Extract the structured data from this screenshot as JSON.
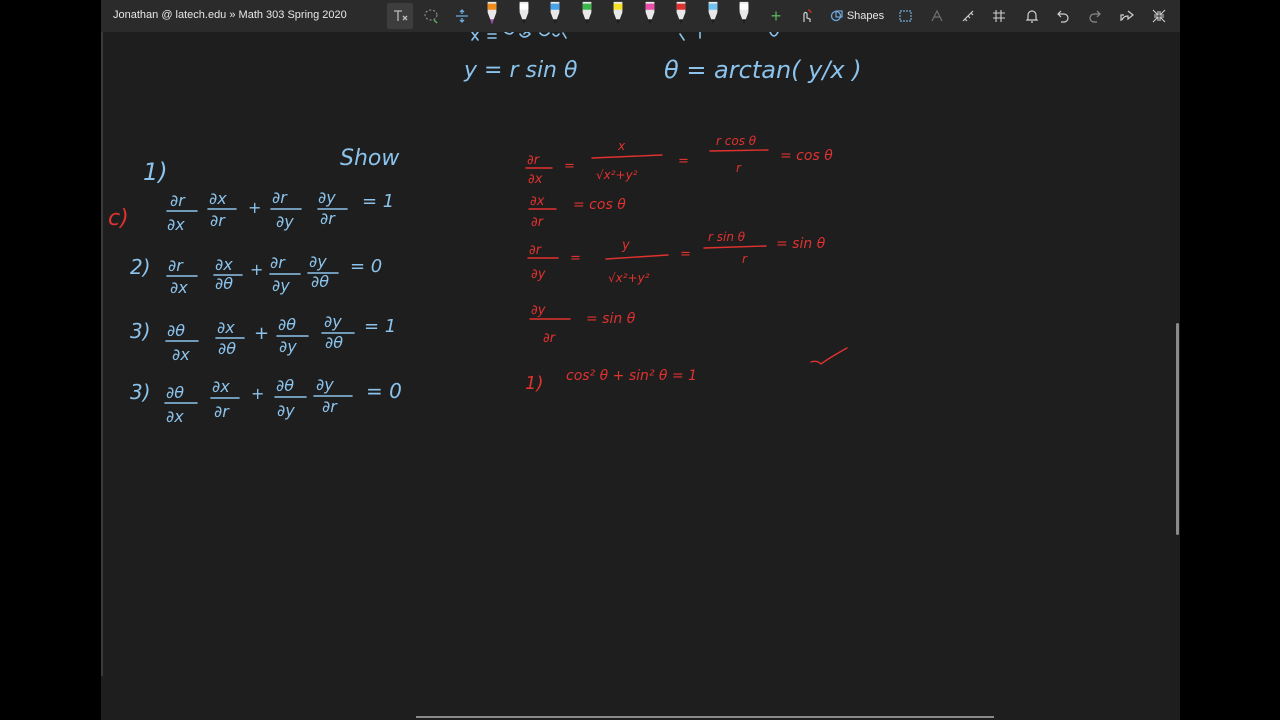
{
  "toolbar": {
    "breadcrumb": "Jonathan @ latech.edu » Math 303 Spring 2020",
    "shapes_label": "Shapes",
    "pens": [
      {
        "name": "pen-orange",
        "color": "#f08c1e",
        "tip": "#a94fb8"
      },
      {
        "name": "pen-white-1",
        "color": "#ffffff"
      },
      {
        "name": "pen-blue",
        "color": "#4aa3e8"
      },
      {
        "name": "pen-green",
        "color": "#3cb54a"
      },
      {
        "name": "highlighter-yellow",
        "color": "#f5e12a"
      },
      {
        "name": "pen-pink",
        "color": "#e94fa8"
      },
      {
        "name": "pen-red",
        "color": "#e0322f"
      },
      {
        "name": "pen-lightblue",
        "color": "#6fc3f0"
      },
      {
        "name": "pen-white-2",
        "color": "#ffffff"
      }
    ]
  },
  "ink": {
    "top_left": "y = r sin θ",
    "top_right": "θ = arctan( y/x )",
    "problem_label": "1)",
    "show": "Show",
    "circle_c": "c)",
    "eq1": [
      "∂r",
      "∂x",
      "∂x",
      "∂r",
      "+",
      "∂r",
      "∂y",
      "∂y",
      "∂r",
      "= 1"
    ],
    "eq2_label": "2)",
    "eq2": [
      "∂r",
      "∂x",
      "∂x",
      "∂θ",
      "+",
      "∂r",
      "∂y",
      "∂y",
      "∂θ",
      "= 0"
    ],
    "eq3_label": "3)",
    "eq3": [
      "∂θ",
      "∂x",
      "∂x",
      "∂θ",
      "+",
      "∂θ",
      "∂y",
      "∂y",
      "∂θ",
      "= 1"
    ],
    "eq4_label": "3)",
    "eq4": [
      "∂θ",
      "∂x",
      "∂x",
      "∂r",
      "+",
      "∂θ",
      "∂y",
      "∂y",
      "∂r",
      "= 0"
    ],
    "red_lines": [
      [
        "∂r",
        "∂x",
        "=",
        "x",
        "√x²+y²",
        "=",
        "r cos θ",
        "r",
        "= cos θ"
      ],
      [
        "∂x",
        "∂r",
        "= cos θ"
      ],
      [
        "∂r",
        "∂y",
        "=",
        "y",
        "√x²+y²",
        "=",
        "r sin θ",
        "r",
        "= sin θ"
      ],
      [
        "∂y",
        "∂r",
        "= sin θ"
      ]
    ],
    "result_label": "1)",
    "result": "cos² θ + sin² θ = 1"
  }
}
